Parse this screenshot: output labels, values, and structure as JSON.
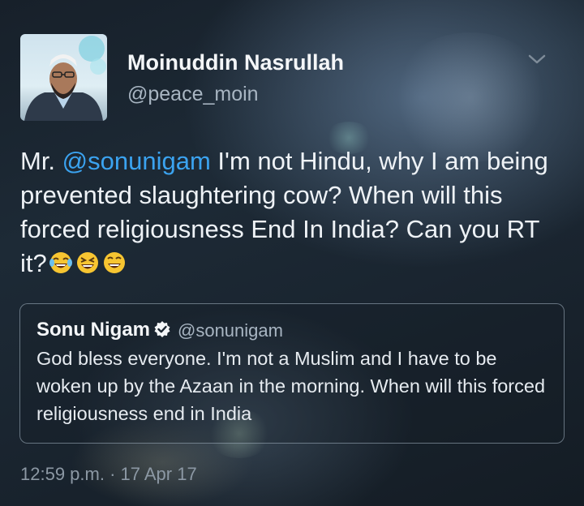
{
  "tweet": {
    "author_name": "Moinuddin Nasrullah",
    "author_handle": "@peace_moin",
    "text_before_mention": "Mr. ",
    "mention": "@sonunigam",
    "text_after_mention": " I'm not Hindu, why I am being prevented slaughtering cow? When will this forced religiousness End In India? Can you RT it?",
    "emojis": [
      "face-with-tears-of-joy-icon",
      "grinning-squinting-face-icon",
      "grinning-squinting-face-icon"
    ],
    "timestamp": "12:59 p.m. · 17 Apr 17"
  },
  "quoted_tweet": {
    "author_name": "Sonu Nigam",
    "author_handle": "@sonunigam",
    "verified_icon": "verified-badge-icon",
    "text": "God bless everyone. I'm not a Muslim and I have to be woken up by the Azaan in the morning. When will this forced religiousness end in India"
  },
  "colors": {
    "mention": "#3ba3f0",
    "handle": "#a8b5c2",
    "timestamp": "#8c98a4"
  }
}
